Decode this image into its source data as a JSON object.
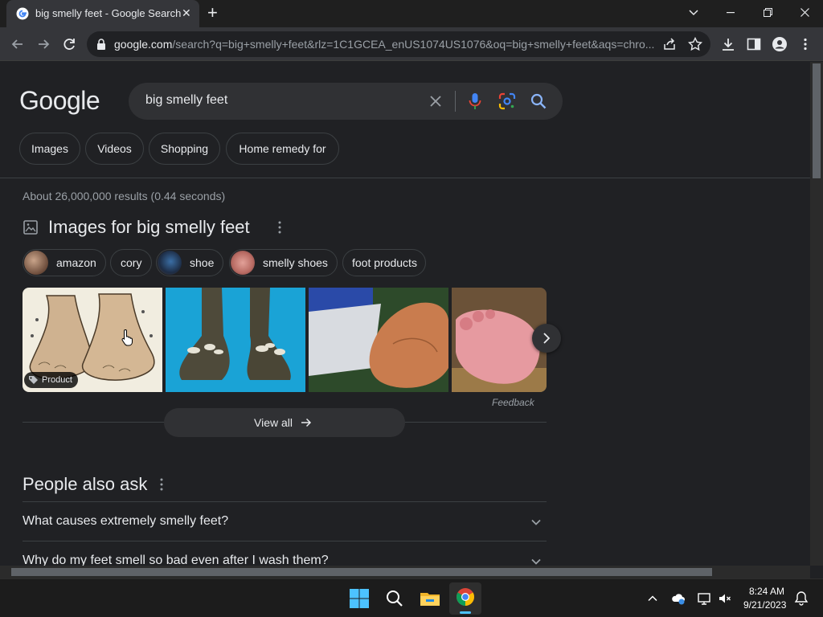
{
  "browser": {
    "tab_title": "big smelly feet - Google Search",
    "url_host": "google.com",
    "url_rest": "/search?q=big+smelly+feet&rlz=1C1GCEA_enUS1074US1076&oq=big+smelly+feet&aqs=chro..."
  },
  "search": {
    "logo": "Google",
    "query": "big smelly feet"
  },
  "filters": [
    "Images",
    "Videos",
    "Shopping",
    "Home remedy for"
  ],
  "results": {
    "stats": "About 26,000,000 results (0.44 seconds)",
    "images_heading": "Images for big smelly feet",
    "related_chips": [
      "amazon",
      "cory",
      "shoe",
      "smelly shoes",
      "foot products"
    ],
    "product_badge": "Product",
    "feedback": "Feedback",
    "view_all": "View all"
  },
  "people_also_ask": {
    "heading": "People also ask",
    "questions": [
      "What causes extremely smelly feet?",
      "Why do my feet smell so bad even after I wash them?"
    ]
  },
  "taskbar": {
    "time": "8:24 AM",
    "date": "9/21/2023"
  },
  "colors": {
    "page_bg": "#202124",
    "surface": "#303134",
    "text": "#e8eaed",
    "muted": "#9aa0a6",
    "link_blue": "#8ab4f8"
  }
}
